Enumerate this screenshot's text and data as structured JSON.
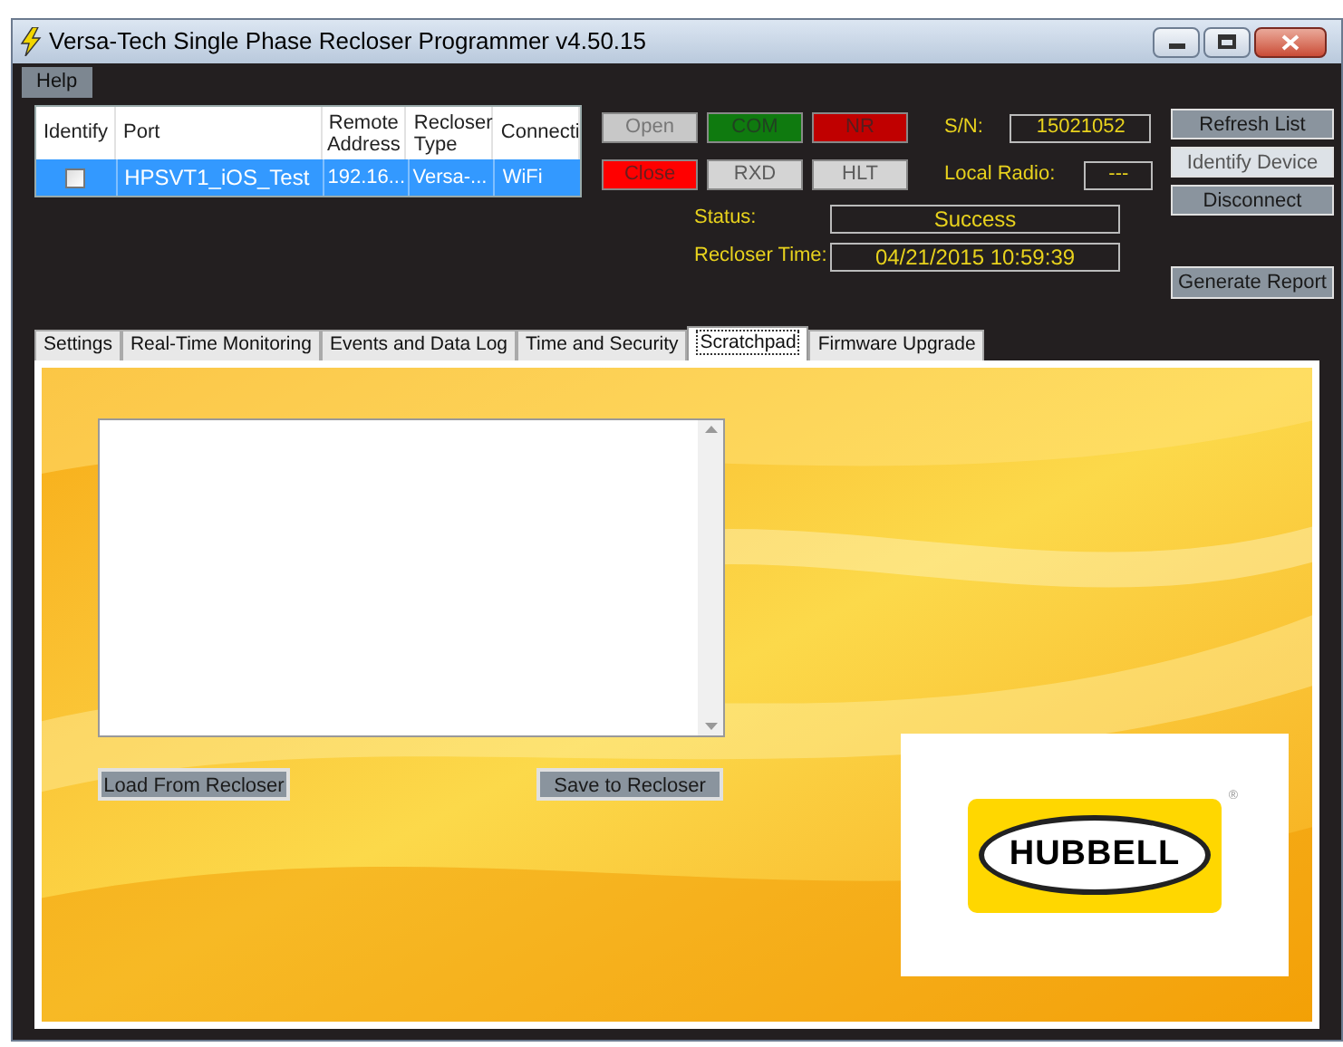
{
  "window": {
    "title": "Versa-Tech Single Phase Recloser Programmer v4.50.15"
  },
  "menu": [
    "Help"
  ],
  "port_table": {
    "columns": [
      "Identify",
      "Port",
      "Remote Address",
      "Recloser Type",
      "Connecti"
    ],
    "rows": [
      {
        "checked": false,
        "selected": true,
        "cells": [
          "",
          "HPSVT1_iOS_Test",
          "192.16...",
          "Versa-...",
          "WiFi"
        ]
      }
    ]
  },
  "indicators": [
    {
      "label": "Open",
      "color": "#c8c8c8",
      "disabled": true
    },
    {
      "label": "COM",
      "color": "#0f7a0f",
      "disabled": false
    },
    {
      "label": "NR",
      "color": "#c00000",
      "disabled": false
    },
    {
      "label": "Close",
      "color": "#ff0000",
      "disabled": false
    },
    {
      "label": "RXD",
      "color": "#d4d4d4",
      "disabled": false
    },
    {
      "label": "HLT",
      "color": "#d4d4d4",
      "disabled": false
    }
  ],
  "info": {
    "sn_label": "S/N:",
    "sn": "15021052",
    "radio_label": "Local Radio:",
    "radio": "---",
    "status_label": "Status:",
    "status": "Success",
    "time_label": "Recloser Time:",
    "time": "04/21/2015 10:59:39"
  },
  "side_buttons": [
    {
      "label": "Refresh List",
      "hot": false
    },
    {
      "label": "Identify Device",
      "hot": true
    },
    {
      "label": "Disconnect",
      "hot": false
    }
  ],
  "report_button": "Generate Report",
  "tabs": [
    {
      "label": "Settings",
      "selected": false
    },
    {
      "label": "Real-Time Monitoring",
      "selected": false
    },
    {
      "label": "Events and Data Log",
      "selected": false
    },
    {
      "label": "Time and Security",
      "selected": false
    },
    {
      "label": "Scratchpad",
      "selected": true
    },
    {
      "label": "Firmware Upgrade",
      "selected": false
    }
  ],
  "scratchpad": {
    "load_button": "Load From Recloser",
    "save_button": "Save to Recloser"
  },
  "logo": {
    "text": "HUBBELL",
    "mark": "®"
  }
}
